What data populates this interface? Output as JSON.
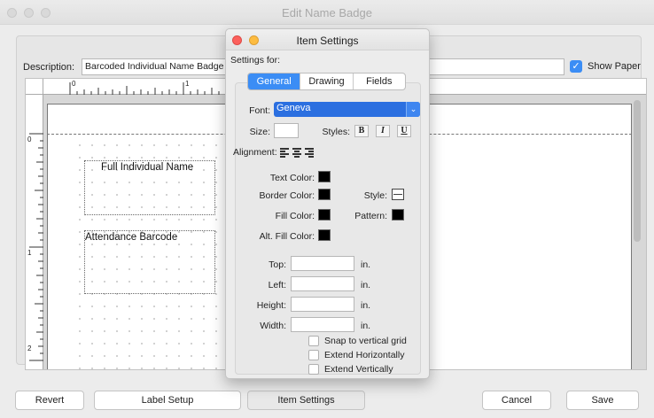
{
  "window": {
    "title": "Edit Name Badge"
  },
  "description": {
    "label": "Description:",
    "value": "Barcoded Individual Name Badge"
  },
  "show_paper": {
    "label": "Show Paper",
    "checked": true
  },
  "ruler": {
    "top_marks": [
      "0",
      "1"
    ],
    "left_marks": [
      "0",
      "1",
      "2"
    ]
  },
  "label_fields": [
    {
      "text": "Full Individual Name"
    },
    {
      "text": "Attendance Barcode"
    }
  ],
  "buttons": {
    "revert": "Revert",
    "label_setup": "Label Setup",
    "item_settings": "Item Settings",
    "cancel": "Cancel",
    "save": "Save"
  },
  "item_settings": {
    "title": "Item Settings",
    "settings_for": "Settings for:",
    "tabs": [
      "General",
      "Drawing",
      "Fields"
    ],
    "active_tab": "General",
    "font": {
      "label": "Font:",
      "value": "Geneva"
    },
    "size": {
      "label": "Size:",
      "value": ""
    },
    "styles": {
      "label": "Styles:",
      "bold": "B",
      "italic": "I",
      "underline": "U"
    },
    "alignment": {
      "label": "Alignment:"
    },
    "text_color": {
      "label": "Text Color:",
      "color": "#000000"
    },
    "border_color": {
      "label": "Border Color:",
      "color": "#000000"
    },
    "style": {
      "label": "Style:"
    },
    "fill_color": {
      "label": "Fill Color:",
      "color": "#000000"
    },
    "pattern": {
      "label": "Pattern:",
      "color": "#000000"
    },
    "alt_fill_color": {
      "label": "Alt. Fill Color:",
      "color": "#000000"
    },
    "top": {
      "label": "Top:",
      "value": "",
      "unit": "in."
    },
    "left": {
      "label": "Left:",
      "value": "",
      "unit": "in."
    },
    "height": {
      "label": "Height:",
      "value": "",
      "unit": "in."
    },
    "width": {
      "label": "Width:",
      "value": "",
      "unit": "in."
    },
    "snap_vertical": {
      "label": "Snap to vertical grid",
      "checked": false
    },
    "extend_horizontally": {
      "label": "Extend Horizontally",
      "checked": false
    },
    "extend_vertically": {
      "label": "Extend Vertically",
      "checked": false
    }
  },
  "colors": {
    "accent": "#3b8df5",
    "close": "#fc605c",
    "minimize": "#fdbc40"
  }
}
